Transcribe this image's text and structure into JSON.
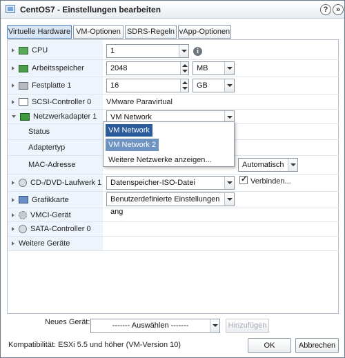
{
  "window": {
    "title": "CentOS7 - Einstellungen bearbeiten",
    "help_label": "?",
    "close_label": "»"
  },
  "tabs": [
    {
      "label": "Virtuelle Hardware",
      "active": true
    },
    {
      "label": "VM-Optionen",
      "active": false
    },
    {
      "label": "SDRS-Regeln",
      "active": false
    },
    {
      "label": "vApp-Optionen",
      "active": false
    }
  ],
  "hardware": {
    "cpu": {
      "label": "CPU",
      "value": "1",
      "info": "i"
    },
    "memory": {
      "label": "Arbeitsspeicher",
      "value": "2048",
      "unit": "MB"
    },
    "disk": {
      "label": "Festplatte 1",
      "value": "16",
      "unit": "GB"
    },
    "scsi": {
      "label": "SCSI-Controller 0",
      "value": "VMware Paravirtual"
    },
    "network": {
      "label": "Netzwerkadapter 1",
      "value": "VM Network",
      "status_label": "Status",
      "adaptertype_label": "Adaptertyp",
      "mac_label": "MAC-Adresse",
      "mac_mode": "Automatisch",
      "options": [
        "VM Network",
        "VM Network 2",
        "Weitere Netzwerke anzeigen..."
      ]
    },
    "cd": {
      "label": "CD-/DVD-Laufwerk 1",
      "value": "Datenspeicher-ISO-Datei",
      "connect_label": "Verbinden..."
    },
    "gpu": {
      "label": "Grafikkarte",
      "value": "Benutzerdefinierte Einstellungen ang"
    },
    "vmci": {
      "label": "VMCI-Gerät"
    },
    "sata": {
      "label": "SATA-Controller 0"
    },
    "other": {
      "label": "Weitere Geräte"
    }
  },
  "new_device": {
    "label": "Neues Gerät:",
    "select_value": "------- Auswählen -------",
    "add_label": "Hinzufügen"
  },
  "footer": {
    "compatibility": "Kompatibilität: ESXi 5.5 und höher (VM-Version 10)",
    "ok_label": "OK",
    "cancel_label": "Abbrechen"
  }
}
